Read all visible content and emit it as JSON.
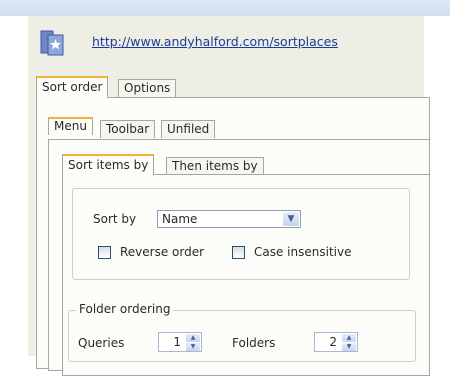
{
  "header": {
    "url": "http://www.andyhalford.com/sortplaces"
  },
  "outer_tabs": [
    {
      "label": "Sort order",
      "active": true
    },
    {
      "label": "Options",
      "active": false
    }
  ],
  "middle_tabs": [
    {
      "label": "Menu",
      "active": true
    },
    {
      "label": "Toolbar",
      "active": false
    },
    {
      "label": "Unfiled",
      "active": false
    }
  ],
  "inner_tabs": [
    {
      "label": "Sort items by",
      "active": true
    },
    {
      "label": "Then items by",
      "active": false
    }
  ],
  "sort_section": {
    "sort_by_label": "Sort by",
    "sort_by_value": "Name",
    "reverse_order_label": "Reverse order",
    "reverse_order_checked": false,
    "case_insensitive_label": "Case insensitive",
    "case_insensitive_checked": false
  },
  "folder_ordering": {
    "legend": "Folder ordering",
    "queries_label": "Queries",
    "queries_value": "1",
    "folders_label": "Folders",
    "folders_value": "2"
  },
  "icons": {
    "app": "sortplaces-app-icon",
    "dropdown": "chevron-down-icon",
    "spin_up": "arrow-up-icon",
    "spin_down": "arrow-down-icon"
  },
  "colors": {
    "link": "#1c3b9a",
    "active_tab_accent": "#f4b333",
    "dialog_bg": "#efeee4"
  }
}
